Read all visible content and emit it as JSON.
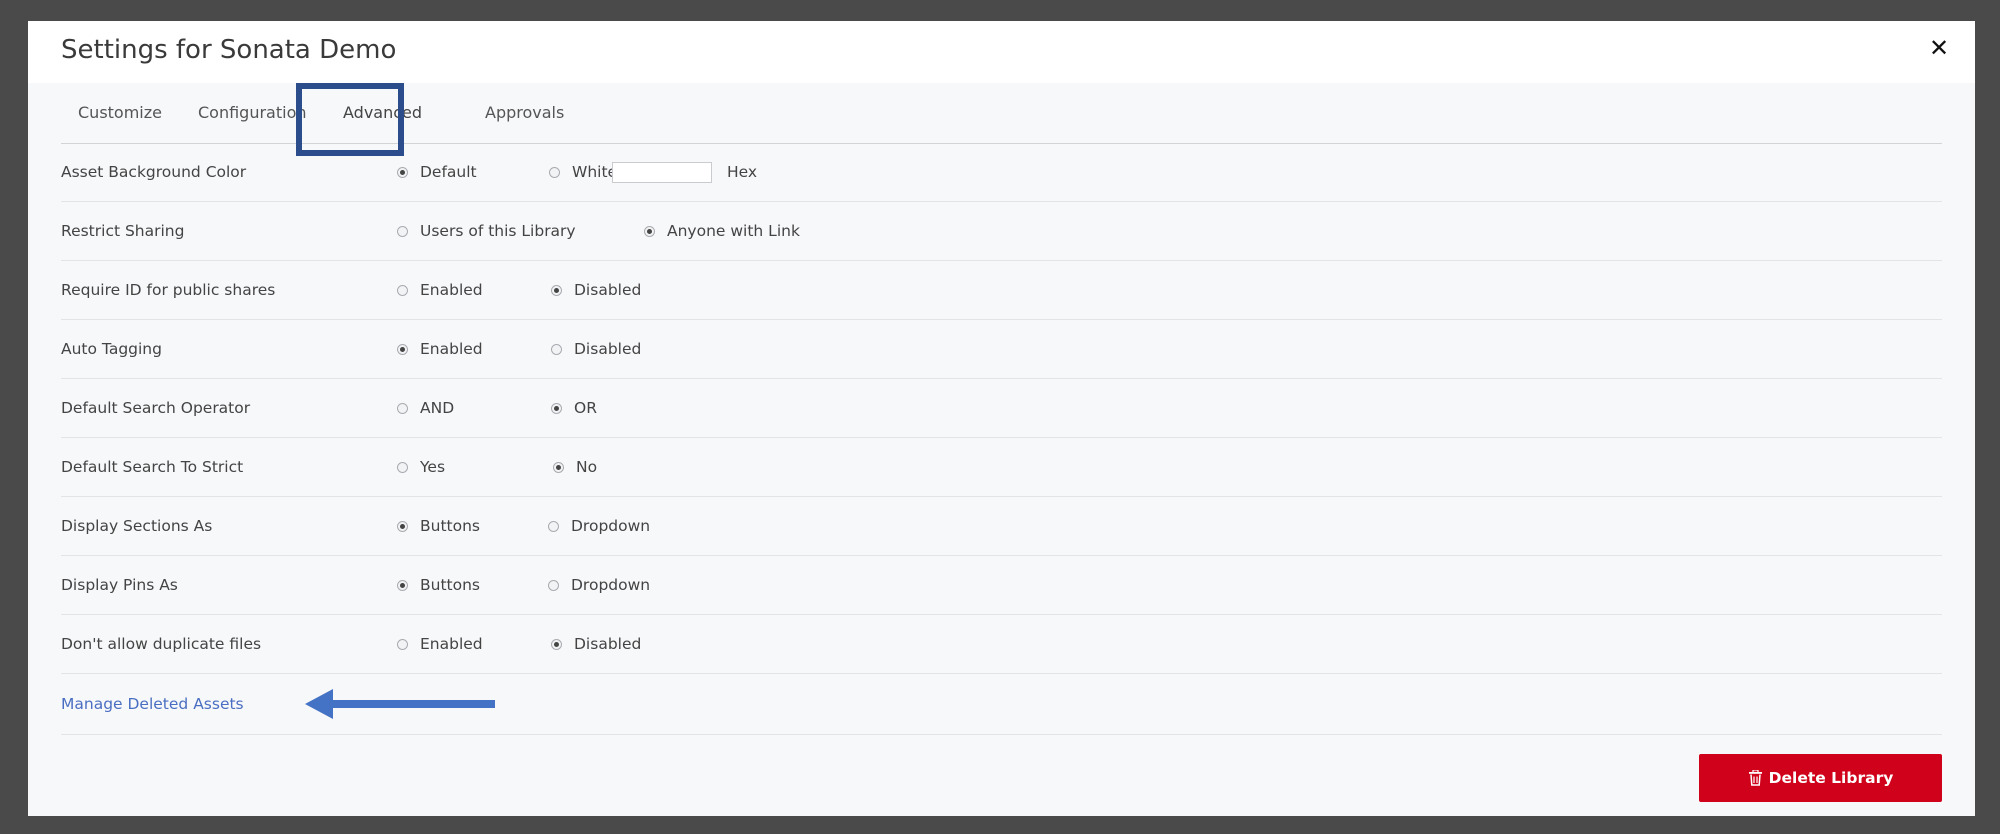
{
  "modal": {
    "title": "Settings for Sonata Demo",
    "close_label": "✕"
  },
  "tabs": [
    {
      "label": "Customize",
      "active": false
    },
    {
      "label": "Configuration",
      "active": false
    },
    {
      "label": "Advanced",
      "active": true
    },
    {
      "label": "Approvals",
      "active": false
    }
  ],
  "settings": [
    {
      "label": "Asset Background Color",
      "options": [
        {
          "label": "Default",
          "checked": true
        },
        {
          "label": "White",
          "checked": false
        }
      ],
      "hex_label": "Hex",
      "hex_value": ""
    },
    {
      "label": "Restrict Sharing",
      "options": [
        {
          "label": "Users of this Library",
          "checked": false
        },
        {
          "label": "Anyone with Link",
          "checked": true
        }
      ]
    },
    {
      "label": "Require ID for public shares",
      "options": [
        {
          "label": "Enabled",
          "checked": false
        },
        {
          "label": "Disabled",
          "checked": true
        }
      ]
    },
    {
      "label": "Auto Tagging",
      "options": [
        {
          "label": "Enabled",
          "checked": true
        },
        {
          "label": "Disabled",
          "checked": false
        }
      ]
    },
    {
      "label": "Default Search Operator",
      "options": [
        {
          "label": "AND",
          "checked": false
        },
        {
          "label": "OR",
          "checked": true
        }
      ]
    },
    {
      "label": "Default Search To Strict",
      "options": [
        {
          "label": "Yes",
          "checked": false
        },
        {
          "label": "No",
          "checked": true
        }
      ]
    },
    {
      "label": "Display Sections As",
      "options": [
        {
          "label": "Buttons",
          "checked": true
        },
        {
          "label": "Dropdown",
          "checked": false
        }
      ]
    },
    {
      "label": "Display Pins As",
      "options": [
        {
          "label": "Buttons",
          "checked": true
        },
        {
          "label": "Dropdown",
          "checked": false
        }
      ]
    },
    {
      "label": "Don't allow duplicate files",
      "options": [
        {
          "label": "Enabled",
          "checked": false
        },
        {
          "label": "Disabled",
          "checked": true
        }
      ]
    }
  ],
  "manage_link": "Manage Deleted Assets",
  "delete_button": "Delete Library",
  "colors": {
    "highlight_box": "#2b4d8c",
    "arrow": "#4472c4",
    "link": "#4a6fc2",
    "delete": "#d0021b"
  },
  "icons": {
    "close": "close-icon",
    "trash": "trash-icon",
    "arrow": "arrow-left-icon"
  }
}
